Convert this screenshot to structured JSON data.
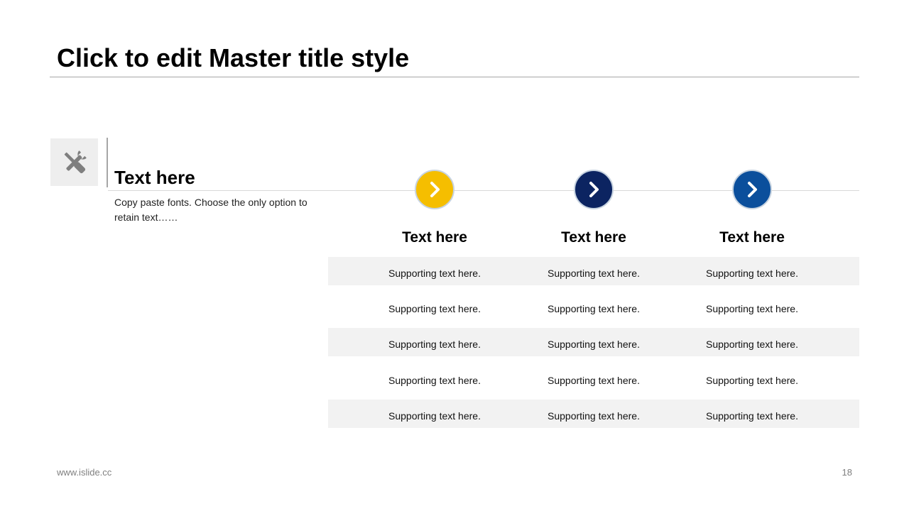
{
  "slide": {
    "title": "Click to edit Master title style",
    "feature": {
      "icon": "tools-icon",
      "heading": "Text here",
      "description": "Copy paste fonts. Choose the only option to retain text……"
    },
    "columns": [
      {
        "heading": "Text here",
        "icon": "chevron-right-icon",
        "color": "#F5BE00"
      },
      {
        "heading": "Text here",
        "icon": "chevron-right-icon",
        "color": "#0C2461"
      },
      {
        "heading": "Text here",
        "icon": "chevron-right-icon",
        "color": "#0B4F9C"
      }
    ],
    "rows": [
      [
        "Supporting text here.",
        "Supporting text here.",
        "Supporting text here."
      ],
      [
        "Supporting text here.",
        "Supporting text here.",
        "Supporting text here."
      ],
      [
        "Supporting text here.",
        "Supporting text here.",
        "Supporting text here."
      ],
      [
        "Supporting text here.",
        "Supporting text here.",
        "Supporting text here."
      ],
      [
        "Supporting text here.",
        "Supporting text here.",
        "Supporting text here."
      ]
    ],
    "footer": {
      "url": "www.islide.cc",
      "page_number": "18"
    }
  }
}
